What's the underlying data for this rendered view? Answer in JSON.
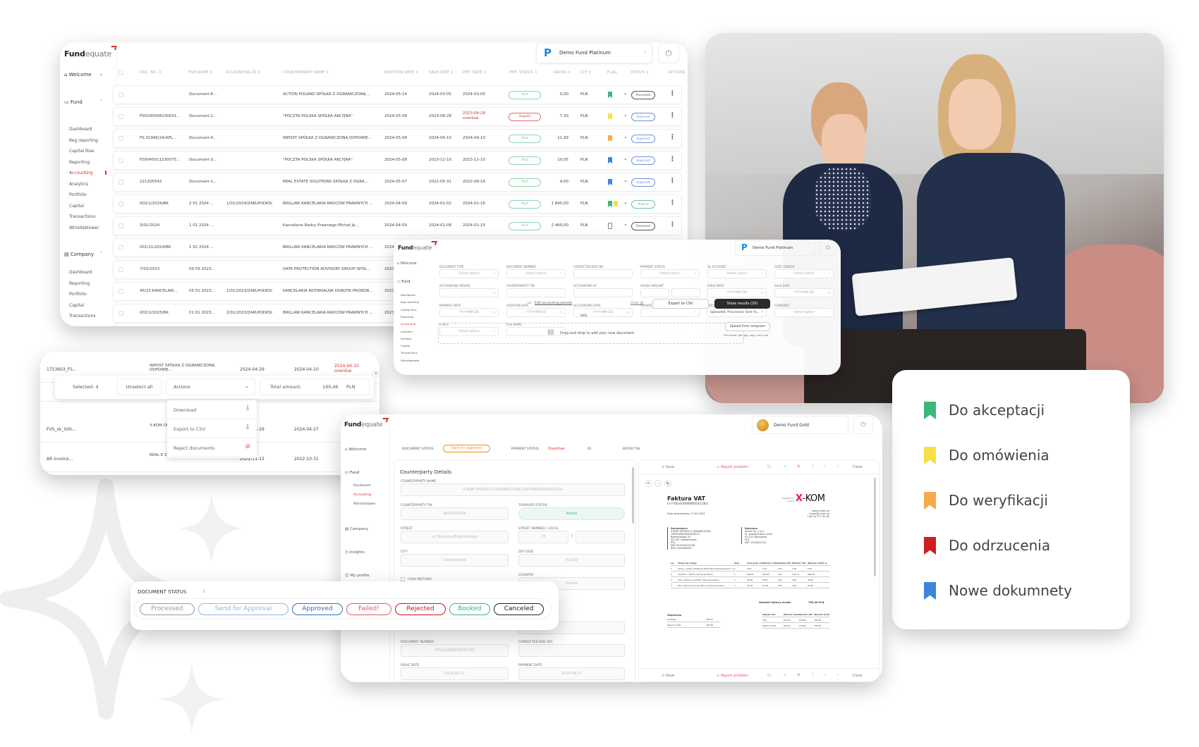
{
  "colors": {
    "accent": "#d32f2f",
    "flag_green": "#3cb878",
    "flag_yellow": "#f5e04a",
    "flag_orange": "#f7a94a",
    "flag_red": "#cc1f1f",
    "flag_blue": "#3b86d8"
  },
  "brand": {
    "bold": "Fund",
    "light": "equate"
  },
  "main_window": {
    "fund_selector": "Demo Fund Platinum",
    "sidebar": {
      "welcome": "Welcome",
      "fund": "Fund",
      "fund_items": [
        "Dashboard",
        "Reg reporting",
        "Capital Rise",
        "Reporting",
        "Accounting",
        "Analytics",
        "Portfolio",
        "Capital",
        "Transactions",
        "Whistleblower"
      ],
      "active_item": "Accounting",
      "company": "Company",
      "company_items": [
        "Dashboard",
        "Reporting",
        "Portfolio",
        "Capital",
        "Transactions"
      ]
    },
    "columns": [
      "DOC. NO. ⇕",
      "FILE NAME ⇕",
      "ACCOUNTING ID ⇕",
      "COUNTERPARTY NAME ⇕",
      "ADDITION DATE ⇕",
      "SALE DATE ⇕",
      "PMT. DATE ⇕",
      "PMT. STATUS ⇕",
      "GROSS ⇕",
      "CCY ⇕",
      "FLAG",
      "STATUS ⇕",
      "ACTIONS"
    ],
    "rows": [
      {
        "doc": "",
        "file": "Document-8...",
        "acc": "",
        "cp": "ACTION POLAND SPÓŁKA Z OGRANICZONĄ ...",
        "add": "2024-05-14",
        "sale": "2024-03-05",
        "pmt": "2024-03-05",
        "overdue": "",
        "pstatus": "Paid",
        "gross": "0,00",
        "ccy": "PLN",
        "flags": [
          "green"
        ],
        "status": "Processed"
      },
      {
        "doc": "F00200008230031...",
        "file": "Document-1...",
        "acc": "",
        "cp": "\"POCZTA POLSKA SPÓŁKA AKCYJNA\"",
        "add": "2024-05-08",
        "sale": "2023-08-28",
        "pmt": "2023-08-28",
        "overdue": "overdue",
        "pstatus": "Unpaid",
        "gross": "7,30",
        "ccy": "PLN",
        "flags": [
          "yellow"
        ],
        "status": "Approved"
      },
      {
        "doc": "FS-31996/24/APL...",
        "file": "Document-4...",
        "acc": "",
        "cp": "INPOST SPÓŁKA Z OGRANICZONĄ ODPOWIE...",
        "add": "2024-05-08",
        "sale": "2024-04-10",
        "pmt": "2024-04-10",
        "overdue": "",
        "pstatus": "Paid",
        "gross": "11,99",
        "ccy": "PLN",
        "flags": [
          "orange"
        ],
        "status": "Approved"
      },
      {
        "doc": "F00045011230075...",
        "file": "Document-3...",
        "acc": "",
        "cp": "\"POCZTA POLSKA SPÓŁKA AKCYJNA\"",
        "add": "2024-05-08",
        "sale": "2023-11-10",
        "pmt": "2023-11-10",
        "overdue": "",
        "pstatus": "Paid",
        "gross": "10,05",
        "ccy": "PLN",
        "flags": [
          "blue"
        ],
        "status": "Approved"
      },
      {
        "doc": "221205542",
        "file": "Document-1...",
        "acc": "",
        "cp": "REAL ESTATE SOLUTIONS SPÓŁKA Z OGRA...",
        "add": "2024-05-07",
        "sale": "2022-05-31",
        "pmt": "2022-06-14",
        "overdue": "",
        "pstatus": "Paid",
        "gross": "4,00",
        "ccy": "PLN",
        "flags": [
          "blue"
        ],
        "status": "Approved"
      },
      {
        "doc": "002/1/2024/BK",
        "file": "2 01 2024 ...",
        "acc": "1/01/2024/ZAKUP/IDKSI",
        "cp": "BRILLAW KANCELARIA RADCÓW PRAWNYCH ...",
        "add": "2024-04-09",
        "sale": "2024-01-02",
        "pmt": "2024-01-16",
        "overdue": "",
        "pstatus": "Paid",
        "gross": "1 845,00",
        "ccy": "PLN",
        "flags": [
          "green",
          "yellow"
        ],
        "status": "Booked"
      },
      {
        "doc": "3/01/2024",
        "file": "1 01 2024 ...",
        "acc": "",
        "cp": "Kancelaria Radcy Prawnego Michał Ja...",
        "add": "2024-04-09",
        "sale": "2024-01-08",
        "pmt": "2024-01-15",
        "overdue": "",
        "pstatus": "Paid",
        "gross": "2 460,00",
        "ccy": "PLN",
        "flags": [
          "empty"
        ],
        "status": "Processed"
      },
      {
        "doc": "001/11/2024/BK",
        "file": "1 02 2024 ...",
        "acc": "",
        "cp": "BRILLAW KANCELARIA RADCÓW PRAWNYCH ...",
        "add": "2024"
      },
      {
        "doc": "7/02/2023",
        "file": "09 03 2023...",
        "acc": "",
        "cp": "DATA PROTECTION ADVISORY GROUP SPÓŁ...",
        "add": "2023"
      },
      {
        "doc": "45/23 KANCELARI...",
        "file": "05 01 2023...",
        "acc": "1/01/2023/ZAKUP/IDKSI",
        "cp": "KANCELARIA NOTARIALNA DOROTA PRONOB...",
        "add": "2023"
      },
      {
        "doc": "002/1/2023/BK",
        "file": "01 01 2023...",
        "acc": "2/01/2023/ZAKUP/IDKSI",
        "cp": "BRILLAW KANCELARIA RADCÓW PRAWNYCH ...",
        "add": "2023"
      }
    ]
  },
  "filter_window": {
    "fund_selector": "Demo Fund Platinum",
    "sidebar": {
      "welcome": "Welcome",
      "fund": "Fund",
      "items": [
        "Dashboard",
        "Reg reporting",
        "Capital Rise",
        "Reporting",
        "Accounting",
        "Analytics",
        "Portfolio",
        "Capital",
        "Transactions",
        "Whistleblower"
      ]
    },
    "filters": [
      {
        "label": "DOCUMENT TYPE",
        "value": "Select option",
        "kind": "select"
      },
      {
        "label": "DOCUMENT NUMBER",
        "value": "Select option",
        "kind": "select"
      },
      {
        "label": "CORRECTED DOC NO.",
        "value": "",
        "kind": "text"
      },
      {
        "label": "PAYMENT STATUS",
        "value": "Select option",
        "kind": "select"
      },
      {
        "label": "GL ACCOUNT",
        "value": "Select option",
        "kind": "select"
      },
      {
        "label": "COST CENTER",
        "value": "Select option",
        "kind": "select"
      },
      {
        "label": "ACCOUNTING PERIOD",
        "value": "",
        "kind": "date"
      },
      {
        "label": "COUNTERPARTY TIN",
        "value": "",
        "kind": "text"
      },
      {
        "label": "ACCOUNTING ID",
        "value": "",
        "kind": "text"
      },
      {
        "label": "GROSS AMOUNT",
        "value": "",
        "kind": "range"
      },
      {
        "label": "ISSUE DATE",
        "value": "YYYY-MM-DD",
        "kind": "date"
      },
      {
        "label": "SALE DATE",
        "value": "YYYY-MM-DD",
        "kind": "date"
      },
      {
        "label": "PAYMENT DATE",
        "value": "YYYY-MM-DD",
        "kind": "date"
      },
      {
        "label": "ADDITION DATE",
        "value": "YYYY-MM-DD",
        "kind": "date"
      },
      {
        "label": "ACCOUNTING DATE",
        "value": "YYYY-MM-DD",
        "kind": "date"
      },
      {
        "label": "COUNTERPARTY NAME",
        "value": "",
        "kind": "select"
      },
      {
        "label": "DOCUMENT STATUS",
        "value": "Uploaded, Processed, Sent fo...",
        "kind": "select"
      },
      {
        "label": "CURRENCY",
        "value": "Select option",
        "kind": "select"
      },
      {
        "label": "FLAGS",
        "value": "Select option",
        "kind": "select"
      },
      {
        "label": "FILE NAME",
        "value": "",
        "kind": "text"
      }
    ],
    "edit_periods": "Edit accounting periods",
    "clear_all": "Clear all",
    "export_csv": "Export to CSV",
    "show_results": "Show results (20)",
    "hide": "HIDE",
    "dropzone": "Drag and drop to add your new document",
    "upload": "Upload from computer",
    "file_format": "File format: pdf, jpg, png | max 5mb"
  },
  "selection_modal": {
    "rows": [
      {
        "doc": "1753603_FS...",
        "cp": "INPOST SPÓŁKA Z OGRANICZONĄ ODPOWIE...",
        "d1": "2024-04-29",
        "d2": "2024-04-10",
        "d3": "2024-04-10",
        "overdue": "overdue"
      },
      {
        "doc": "FVS_xk_000...",
        "cp": "X-KOM ODPOW...",
        "d1": "2024-04-29",
        "d2": "2024-04-27",
        "d3": "",
        "overdue": ""
      },
      {
        "doc": "AR invoice...",
        "cp": "REAL E Z OGRA...",
        "d1": "2022-11-13",
        "d2": "2022-10-31",
        "d3": "",
        "overdue": ""
      }
    ],
    "selected": "Selected: 4",
    "unselect_all": "Unselect all",
    "actions": "Actions",
    "total_label": "Total amount:",
    "total_value": "190,46",
    "total_ccy": "PLN",
    "menu": [
      "Download",
      "Export to CSV",
      "Reject documents"
    ]
  },
  "detail_window": {
    "fund_selector": "Demo Fund Gold",
    "sidebar": {
      "welcome": "Welcome",
      "fund": "Fund",
      "items": [
        "Dashboard",
        "Accounting",
        "Whistleblower"
      ],
      "company": "Company",
      "insights": "Insights",
      "profile": "My profile"
    },
    "status_bar": {
      "doc_status_label": "DOCUMENT STATUS",
      "doc_status": "Sent for approval",
      "pay_status_label": "PAYMENT STATUS",
      "pay_status": "Overdue",
      "id_label": "ID",
      "buyer_label": "BUYER TIN"
    },
    "form_title": "Counterparty Details",
    "fields": {
      "cp_name_label": "COUNTERPARTY NAME",
      "cp_name": "X-KOM SPÓŁKA Z OGRANICZONĄ ODPOWIEDZIALNOŚCIĄ",
      "tin_label": "COUNTERPARTY TIN",
      "tin": "9491910706",
      "taxpayer_label": "TAXPAYER STATUS",
      "taxpayer": "Active",
      "street_label": "STREET",
      "street": "ul. Mariusza Bojemskiego",
      "street_no_label": "STREET NUMBER / LOCAL",
      "street_no": "25",
      "local": "",
      "city_label": "CITY",
      "city": "Częstochowa",
      "zip_label": "ZIP CODE",
      "zip": "42-202",
      "country_label": "COUNTRY",
      "country": "Poland",
      "cash_method": "CASH METHOD",
      "docnum_label": "DOCUMENT NUMBER",
      "docnum": "FVS/xk/000000541163",
      "corrected_label": "CORRECTED DOC NO.",
      "corrected": "",
      "issue_label": "ISSUE DATE",
      "issue": "2024-04-27",
      "paydate_label": "PAYMENT DATE",
      "paydate": "2024-04-27"
    },
    "toolbar": {
      "save": "Save",
      "report": "Report problem",
      "close": "Close"
    },
    "invoice": {
      "title": "Faktura VAT",
      "number": "nr FVS/xk/000000541163",
      "date": "Data wystawienia: 27.04.2024",
      "vendor": "x-kom",
      "vendor_tag": "inteligentny wybór",
      "contact": [
        "www.x-kom.pl",
        "x-kom@x-kom.pl",
        "+48 34 377 00 00"
      ],
      "seller_label": "Sprzedawca",
      "seller": [
        "X-KOM SPÓŁKA Z OGRANICZONĄ",
        "ODPOWIEDZIALNOŚCIĄ",
        "Bojemskiego 25",
        "42-202 Częstochowa",
        "POL",
        "NIP: PL9491910706",
        "BDO: 000008941"
      ],
      "buyer_label": "Nabywca",
      "buyer": [
        "Demo Sp. z o.o.",
        "Al. Jerozolimskie 1018",
        "02-222 Warszawa",
        "POL",
        "NIP: 7010612122"
      ],
      "table_head": [
        "Lp.",
        "Towar lub usługa",
        "Ilość",
        "Cena jedn. brutto",
        "Wartość netto",
        "Stawka VAT",
        "Wartość VAT",
        "Wartość brutto w PLN"
      ],
      "table_rows": [
        [
          "1",
          "Usługi - opłaty dodatkowe Biała Marszałkowska Kurier 1 szt",
          "1",
          "6,50",
          "5,41",
          "23%",
          "1,09",
          "6,50"
        ],
        [
          "2",
          "Smartfon / Telefon Samsung Galaxy",
          "1",
          "696,00",
          "565,85",
          "23%",
          "130,15",
          "696,00"
        ],
        [
          "3",
          "Folie / szkła na smartfon Samsung Galaxy",
          "1",
          "36,99",
          "30,07",
          "23%",
          "6,92",
          "36,99"
        ],
        [
          "4",
          "Etui / pokrowce na smartfony Samsung Galaxy",
          "1",
          "29,99",
          "24,38",
          "23%",
          "5,61",
          "29,99"
        ]
      ],
      "total_label": "Wartość faktury brutto",
      "total": "769,48 PLN",
      "paid_label": "Zapłacono",
      "paid_rows": [
        [
          "Gotówka",
          "769,48"
        ],
        [
          "Razem w PLN",
          "769,48"
        ]
      ],
      "vat_head": [
        "Stawka VAT",
        "Wartość netto",
        "Wartość VAT",
        "Wartość brutto"
      ],
      "vat_rows": [
        [
          "23%",
          "625,59",
          "143,89",
          "769,48"
        ],
        [
          "Razem w PLN",
          "625,59",
          "143,89",
          "769,48"
        ]
      ]
    }
  },
  "document_status_card": {
    "title": "DOCUMENT STATUS",
    "statuses": [
      {
        "label": "Processed",
        "color": "#9a9a9a"
      },
      {
        "label": "Send for Approval",
        "color": "#8fb6e8"
      },
      {
        "label": "Approved",
        "color": "#2f6fc0"
      },
      {
        "label": "Failed!",
        "color": "#e05a6a"
      },
      {
        "label": "Rejected",
        "color": "#c4161c"
      },
      {
        "label": "Booked",
        "color": "#3cb382"
      },
      {
        "label": "Canceled",
        "color": "#222222"
      }
    ]
  },
  "flag_legend": [
    {
      "label": "Do akceptacji",
      "color": "#3cb878"
    },
    {
      "label": "Do omówienia",
      "color": "#f5e04a"
    },
    {
      "label": "Do weryfikacji",
      "color": "#f7a94a"
    },
    {
      "label": "Do odrzucenia",
      "color": "#cc1f1f"
    },
    {
      "label": "Nowe dokumnety",
      "color": "#3b86d8"
    }
  ]
}
